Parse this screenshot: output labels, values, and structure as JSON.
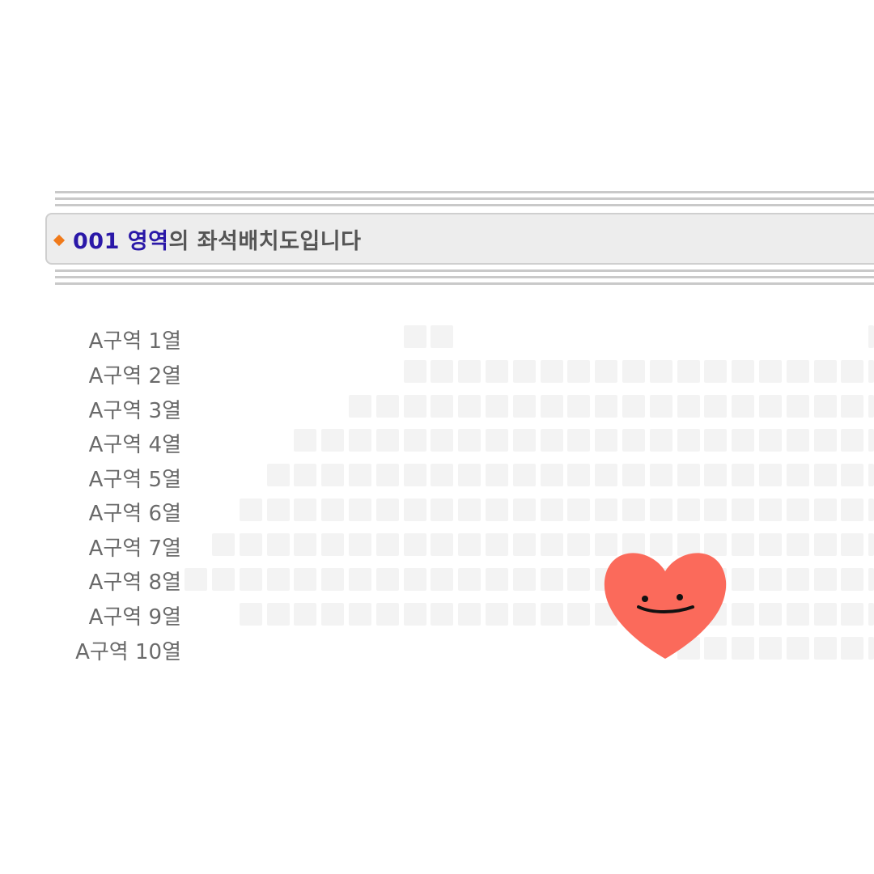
{
  "header": {
    "area_code": "001",
    "area_word": "영역",
    "suffix": "의 좌석배치도입니다"
  },
  "rows": [
    {
      "label": "A구역 1열"
    },
    {
      "label": "A구역 2열"
    },
    {
      "label": "A구역 3열"
    },
    {
      "label": "A구역 4열"
    },
    {
      "label": "A구역 5열"
    },
    {
      "label": "A구역 6열"
    },
    {
      "label": "A구역 7열"
    },
    {
      "label": "A구역 8열"
    },
    {
      "label": "A구역 9열"
    },
    {
      "label": "A구역 10열"
    }
  ],
  "colors": {
    "seat": "#f3f3f3",
    "highlight": "#2a18a8",
    "bullet": "#f07a1a",
    "heart": "#fb6a5b"
  },
  "icons": {
    "bullet": "orange-diamond-icon",
    "sticker": "smiling-heart-sticker"
  }
}
